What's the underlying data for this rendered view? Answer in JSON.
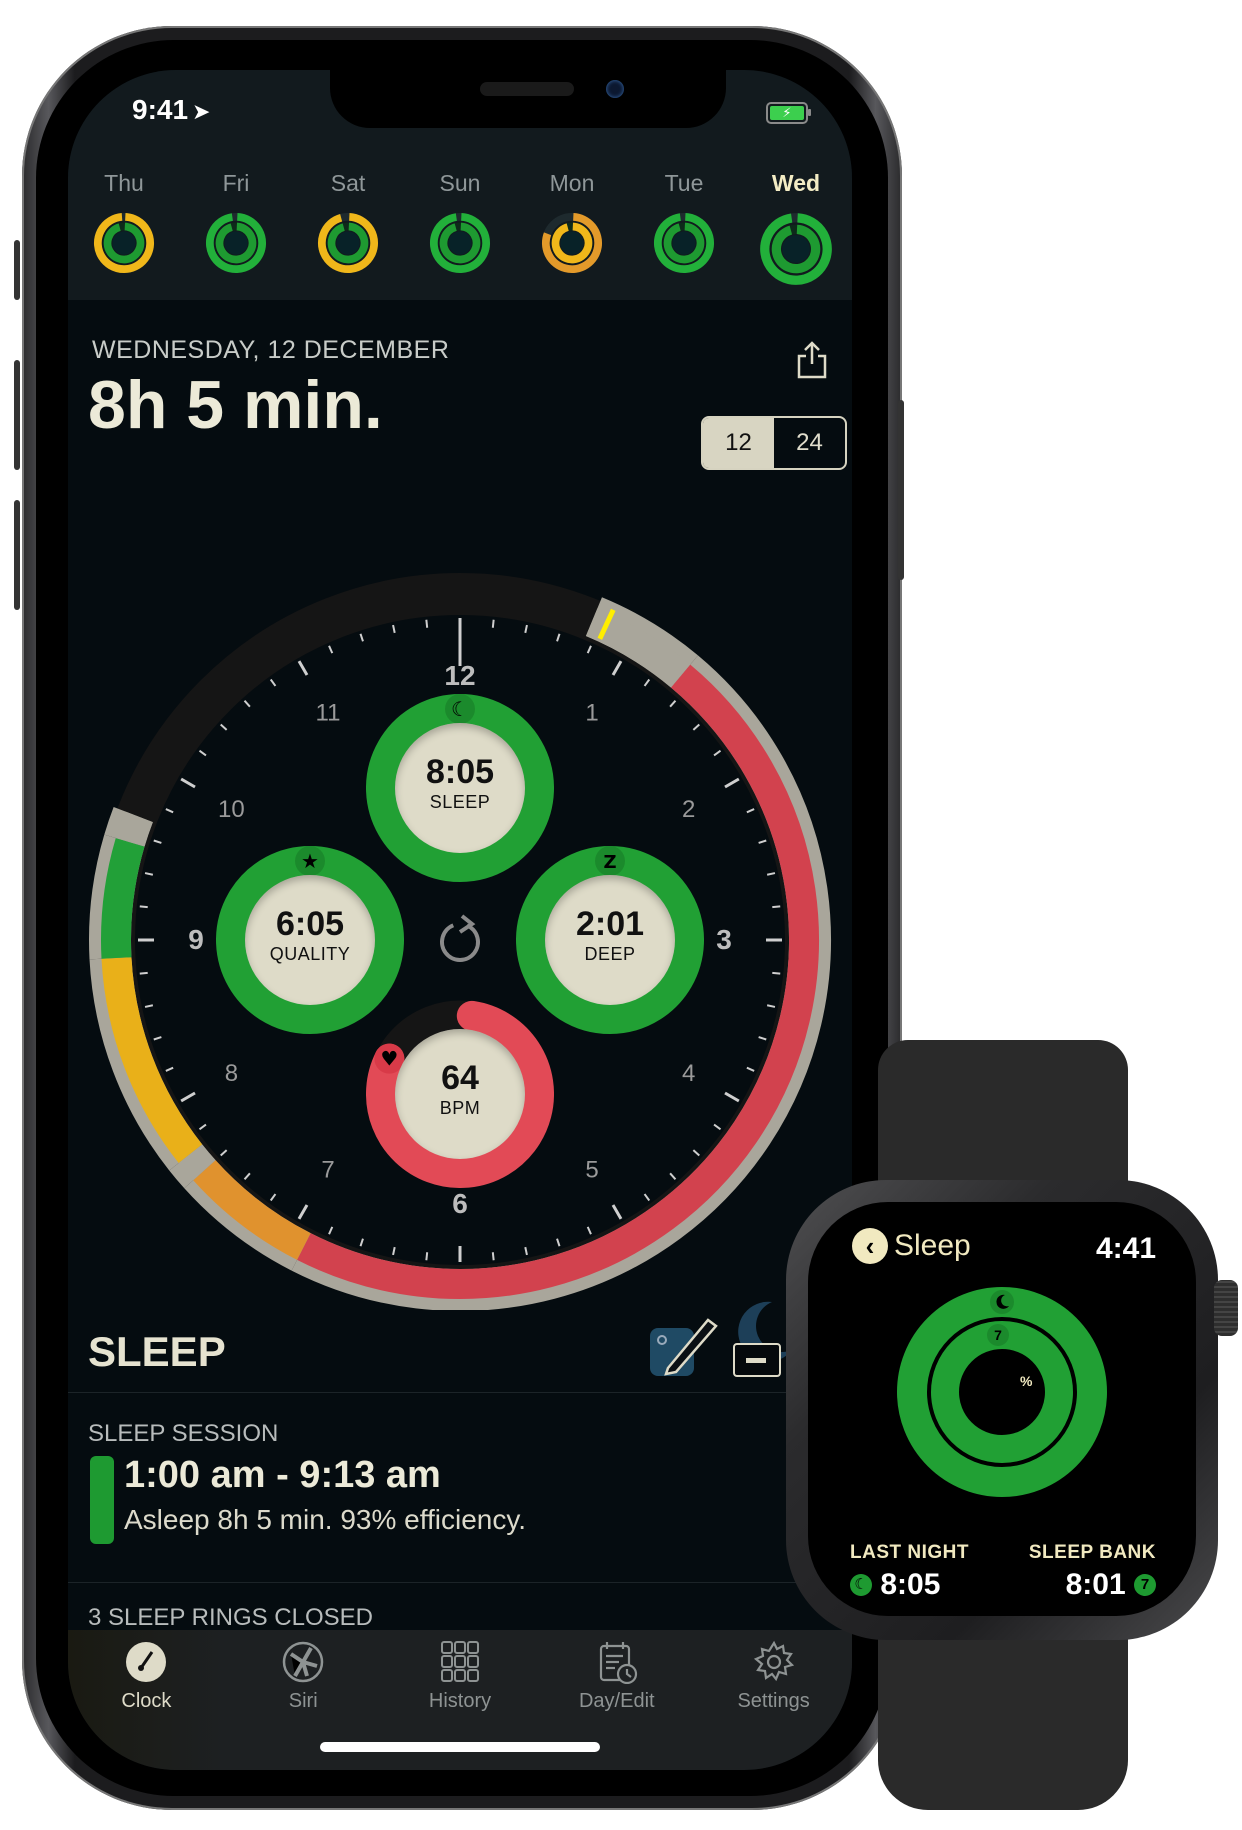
{
  "status_bar": {
    "time": "9:41",
    "location_icon": "location-arrow-icon",
    "battery_icon": "battery-charging-icon"
  },
  "week": [
    {
      "label": "Thu",
      "outer": "#f0b71a",
      "outer_pct": 0.98,
      "inner": "#1e9a31",
      "inner_pct": 0.95,
      "selected": false
    },
    {
      "label": "Fri",
      "outer": "#22b03a",
      "outer_pct": 0.97,
      "inner": "#1e9a31",
      "inner_pct": 0.95,
      "selected": false
    },
    {
      "label": "Sat",
      "outer": "#f0b71a",
      "outer_pct": 0.95,
      "inner": "#1e9a31",
      "inner_pct": 0.95,
      "selected": false
    },
    {
      "label": "Sun",
      "outer": "#22b03a",
      "outer_pct": 0.97,
      "inner": "#1e9a31",
      "inner_pct": 0.95,
      "selected": false
    },
    {
      "label": "Mon",
      "outer": "#e39a2a",
      "outer_pct": 0.8,
      "inner": "#f0b71a",
      "inner_pct": 0.95,
      "selected": false
    },
    {
      "label": "Tue",
      "outer": "#22b03a",
      "outer_pct": 0.97,
      "inner": "#1e9a31",
      "inner_pct": 0.95,
      "selected": false
    },
    {
      "label": "Wed",
      "outer": "#22b03a",
      "outer_pct": 0.97,
      "inner": "#1e9a31",
      "inner_pct": 0.95,
      "selected": true
    }
  ],
  "header": {
    "date": "WEDNESDAY, 12 DECEMBER",
    "duration": "8h 5 min.",
    "share_icon": "share-icon",
    "format_options": [
      "12",
      "24"
    ],
    "format_selected": "12"
  },
  "dial": {
    "hour_labels": [
      "12",
      "1",
      "2",
      "3",
      "4",
      "5",
      "6",
      "7",
      "8",
      "9",
      "10",
      "11"
    ],
    "segments": [
      {
        "from_h": 0.75,
        "to_h": 1.33,
        "color": "#a9a69b"
      },
      {
        "from_h": 1.33,
        "to_h": 6.9,
        "color": "#d2424e"
      },
      {
        "from_h": 6.9,
        "to_h": 7.6,
        "color": "#e0922e"
      },
      {
        "from_h": 7.6,
        "to_h": 7.72,
        "color": "#a9a69b"
      },
      {
        "from_h": 7.72,
        "to_h": 8.9,
        "color": "#e9b019"
      },
      {
        "from_h": 8.9,
        "to_h": 9.55,
        "color": "#22a038"
      },
      {
        "from_h": 9.55,
        "to_h": 9.7,
        "color": "#a9a69b"
      }
    ],
    "marker_hour": 0.83,
    "marker_color": "#ffee00",
    "refresh_icon": "refresh-icon",
    "rings": [
      {
        "id": "sleep",
        "value": "8:05",
        "caption": "SLEEP",
        "icon": "moon-icon",
        "color": "#21a034",
        "progress": 1.0
      },
      {
        "id": "quality",
        "value": "6:05",
        "caption": "QUALITY",
        "icon": "star-icon",
        "color": "#21a034",
        "progress": 1.0
      },
      {
        "id": "deep",
        "value": "2:01",
        "caption": "DEEP",
        "icon": "z-icon",
        "color": "#21a034",
        "progress": 1.0
      },
      {
        "id": "bpm",
        "value": "64",
        "caption": "BPM",
        "icon": "heart-icon",
        "color": "#e24a56",
        "progress": 0.8
      }
    ]
  },
  "sleep_section": {
    "title": "SLEEP",
    "edit_icon": "edit-note-icon",
    "remove_icon": "minus-icon",
    "session_label": "SLEEP SESSION",
    "session_time": "1:00 am - 9:13 am",
    "session_summary": "Asleep 8h 5 min. 93% efficiency.",
    "rings_closed": "3 SLEEP RINGS CLOSED"
  },
  "tabbar": {
    "items": [
      {
        "label": "Clock",
        "icon": "clock-icon",
        "active": true
      },
      {
        "label": "Siri",
        "icon": "siri-icon",
        "active": false
      },
      {
        "label": "History",
        "icon": "grid-icon",
        "active": false
      },
      {
        "label": "Day/Edit",
        "icon": "calendar-clock-icon",
        "active": false
      },
      {
        "label": "Settings",
        "icon": "gear-icon",
        "active": false
      }
    ]
  },
  "watch": {
    "back_label": "Sleep",
    "time": "4:41",
    "center_symbol": "%",
    "inner_badge": "7",
    "last_night_label": "LAST NIGHT",
    "last_night_value": "8:05",
    "sleep_bank_label": "SLEEP BANK",
    "sleep_bank_value": "8:01",
    "sleep_bank_badge": "7",
    "outer_progress": 1.0,
    "inner_progress": 1.0
  }
}
